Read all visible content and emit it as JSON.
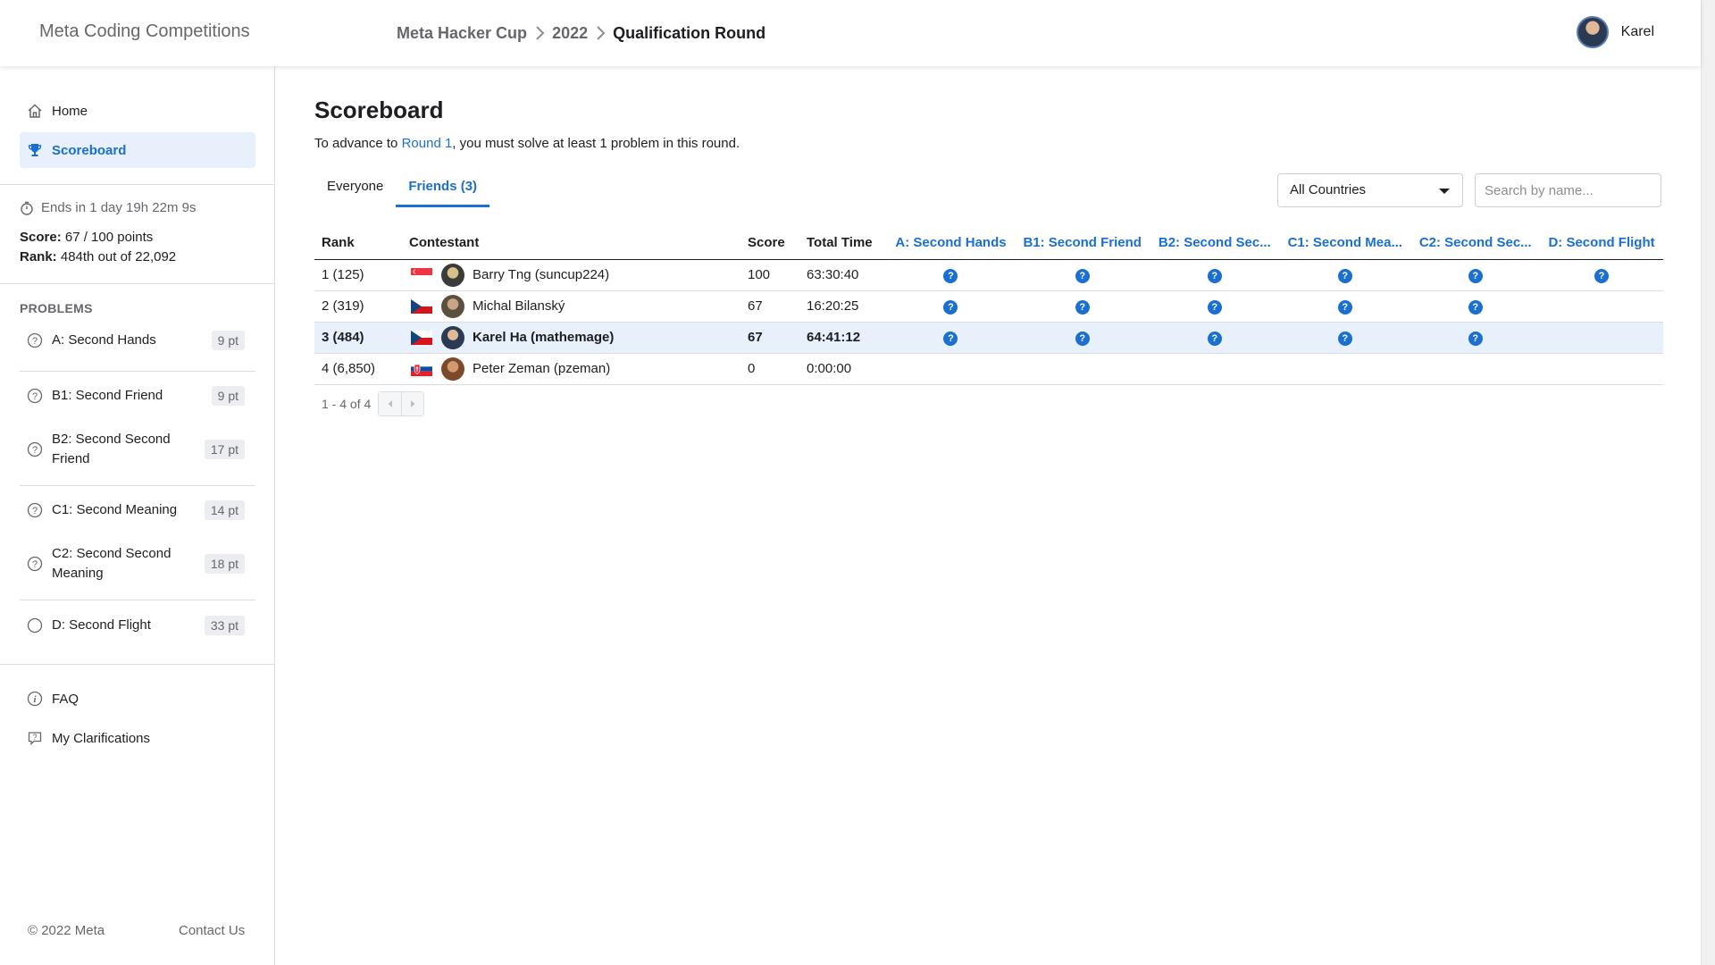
{
  "header": {
    "brand": "Meta Coding Competitions",
    "breadcrumb": [
      "Meta Hacker Cup",
      "2022",
      "Qualification Round"
    ],
    "user_name": "Karel"
  },
  "sidebar": {
    "nav": [
      {
        "label": "Home",
        "icon": "home-icon"
      },
      {
        "label": "Scoreboard",
        "icon": "trophy-icon"
      }
    ],
    "timer": "Ends in 1 day 19h 22m 9s",
    "score_label": "Score:",
    "score_value": "67 / 100 points",
    "rank_label": "Rank:",
    "rank_value": "484th out of 22,092",
    "problems_title": "PROBLEMS",
    "problems": [
      {
        "name": "A: Second Hands",
        "points": "9 pt",
        "icon": "question-circle-icon"
      },
      {
        "name": "B1: Second Friend",
        "points": "9 pt",
        "icon": "question-circle-icon"
      },
      {
        "name": "B2: Second Second Friend",
        "points": "17 pt",
        "icon": "question-circle-icon"
      },
      {
        "name": "C1: Second Meaning",
        "points": "14 pt",
        "icon": "question-circle-icon"
      },
      {
        "name": "C2: Second Second Meaning",
        "points": "18 pt",
        "icon": "question-circle-icon"
      },
      {
        "name": "D: Second Flight",
        "points": "33 pt",
        "icon": "empty-circle-icon"
      }
    ],
    "links": [
      {
        "label": "FAQ",
        "icon": "info-circle-icon"
      },
      {
        "label": "My Clarifications",
        "icon": "chat-question-icon"
      }
    ],
    "copyright": "© 2022 Meta",
    "contact": "Contact Us"
  },
  "main": {
    "title": "Scoreboard",
    "advance_prefix": "To advance to ",
    "advance_link": "Round 1",
    "advance_suffix": ", you must solve at least 1 problem in this round.",
    "tabs": [
      "Everyone",
      "Friends (3)"
    ],
    "active_tab": "Friends (3)",
    "country_select": "All Countries",
    "search_placeholder": "Search by name...",
    "columns": {
      "rank": "Rank",
      "contestant": "Contestant",
      "score": "Score",
      "time": "Total Time",
      "problems": [
        "A: Second Hands",
        "B1: Second Friend",
        "B2: Second Sec...",
        "C1: Second Mea...",
        "C2: Second Sec...",
        "D: Second Flight"
      ]
    },
    "rows": [
      {
        "rank": "1 (125)",
        "name": "Barry Tng (suncup224)",
        "flag": "singapore-flag-icon",
        "score": "100",
        "time": "63:30:40",
        "solved": [
          true,
          true,
          true,
          true,
          true,
          true
        ],
        "highlight": false
      },
      {
        "rank": "2 (319)",
        "name": "Michal Bilanský",
        "flag": "czech-flag-icon",
        "score": "67",
        "time": "16:20:25",
        "solved": [
          true,
          true,
          true,
          true,
          true,
          false
        ],
        "highlight": false
      },
      {
        "rank": "3 (484)",
        "name": "Karel Ha (mathemage)",
        "flag": "czech-flag-icon",
        "score": "67",
        "time": "64:41:12",
        "solved": [
          true,
          true,
          true,
          true,
          true,
          false
        ],
        "highlight": true
      },
      {
        "rank": "4 (6,850)",
        "name": "Peter Zeman (pzeman)",
        "flag": "slovakia-flag-icon",
        "score": "0",
        "time": "0:00:00",
        "solved": [
          false,
          false,
          false,
          false,
          false,
          false
        ],
        "highlight": false
      }
    ],
    "status_glyph": "?",
    "pagination": "1 - 4 of 4"
  },
  "colors": {
    "accent": "#1a6fcf",
    "highlight_row": "#e7f0fb"
  }
}
